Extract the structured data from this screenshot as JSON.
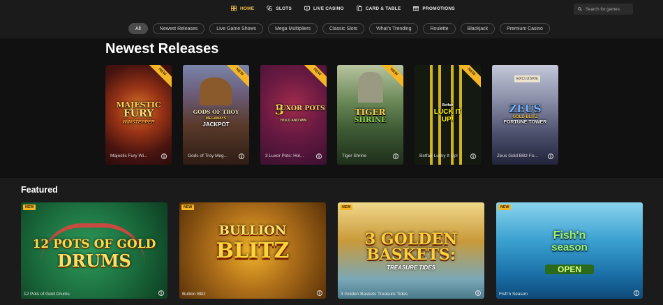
{
  "nav": {
    "items": [
      {
        "label": "HOME",
        "icon": "home-icon",
        "active": true
      },
      {
        "label": "SLOTS",
        "icon": "slots-icon",
        "active": false
      },
      {
        "label": "LIVE CASINO",
        "icon": "live-casino-icon",
        "active": false
      },
      {
        "label": "CARD & TABLE",
        "icon": "card-table-icon",
        "active": false
      },
      {
        "label": "PROMOTIONS",
        "icon": "gift-icon",
        "active": false
      }
    ],
    "search_placeholder": "Search for games"
  },
  "filters": [
    "All",
    "Newest Releases",
    "Live Game Shows",
    "Mega Multipliers",
    "Classic Slots",
    "What's Trending",
    "Roulette",
    "Blackjack",
    "Premium Casino"
  ],
  "active_filter": "All",
  "newest": {
    "title": "Newest Releases",
    "ribbon": "NEW",
    "tiles": [
      {
        "name": "Majestic Fury Wi...",
        "logo_line1": "MAJESTIC",
        "logo_line2": "FURY",
        "logo_line3": "WINSTEPPER"
      },
      {
        "name": "Gods of Troy Meg...",
        "logo_line1": "GODS OF TROY",
        "logo_line2": "MEGAWAYS",
        "logo_line3": "JACKPOT"
      },
      {
        "name": "3 Luxor Pots: Hol...",
        "logo_line1": "3",
        "logo_line2": "LUXOR POTS",
        "logo_line3": "HOLD AND WIN"
      },
      {
        "name": "Tiger Shrine",
        "logo_line1": "TIGER",
        "logo_line2": "SHRINE"
      },
      {
        "name": "Betfair Lucky It Up!",
        "logo_line1": "Betfair",
        "logo_line2": "LUCK IT",
        "logo_line3": "UP!"
      },
      {
        "name": "Zeus Gold Blitz Fo...",
        "badge": "EXCLUSIVE",
        "logo_line1": "ZEUS",
        "logo_line2": "GOLD BLITZ",
        "logo_line3": "FORTUNE TOWER"
      }
    ]
  },
  "featured": {
    "title": "Featured",
    "badge": "NEW",
    "tiles": [
      {
        "name": "12 Pots of Gold Drums",
        "logo_line1": "12 POTS OF GOLD",
        "logo_line2": "DRUMS"
      },
      {
        "name": "Bullion Blitz",
        "logo_line1": "BULLION",
        "logo_line2": "BLITZ"
      },
      {
        "name": "3 Golden Baskets Treasure Tides",
        "logo_line1": "3 GOLDEN",
        "logo_line2": "BASKETS:",
        "logo_line3": "TREASURE TIDES"
      },
      {
        "name": "Fish'n Season",
        "logo_line1": "Fish'n",
        "logo_line2": "season",
        "logo_line3": "OPEN"
      }
    ]
  },
  "info_glyph": "i",
  "colors": {
    "accent": "#f4c34a",
    "ribbon": "#f4b626",
    "background": "#1b1b1b",
    "band": "#111111"
  }
}
